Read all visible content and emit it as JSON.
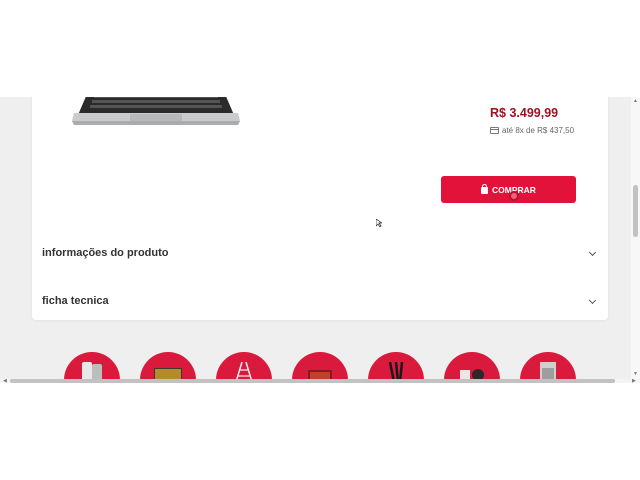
{
  "product": {
    "price": "R$ 3.499,99",
    "installment": "até 8x de R$ 437,50",
    "buy_label": "COMPRAR",
    "image_icon": "laptop-image"
  },
  "accordions": [
    {
      "label": "informações do produto"
    },
    {
      "label": "ficha tecnica"
    }
  ],
  "categories": [
    {
      "icon": "smartphone-icon"
    },
    {
      "icon": "tv-icon"
    },
    {
      "icon": "ladder-icon"
    },
    {
      "icon": "screen-icon"
    },
    {
      "icon": "hair-straightener-icon"
    },
    {
      "icon": "hair-dryer-icon"
    },
    {
      "icon": "refrigerator-icon"
    }
  ],
  "colors": {
    "accent": "#e3123a",
    "price": "#a01122",
    "category_bg": "#d91a3c",
    "page_bg": "#efefef"
  }
}
